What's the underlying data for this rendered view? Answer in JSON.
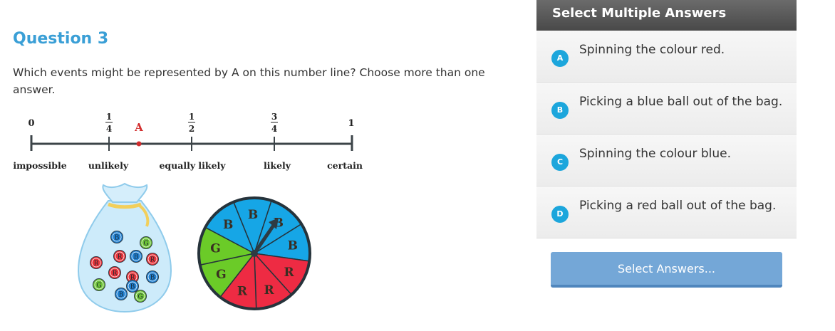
{
  "question": {
    "title": "Question 3",
    "text": "Which events might be represented by A on this number line? Choose more than one answer."
  },
  "number_line": {
    "ticks": [
      {
        "label": "0",
        "caption": "impossible"
      },
      {
        "num": "1",
        "den": "4",
        "caption": "unlikely"
      },
      {
        "num": "1",
        "den": "2",
        "caption": "equally likely"
      },
      {
        "num": "3",
        "den": "4",
        "caption": "likely"
      },
      {
        "label": "1",
        "caption": "certain"
      }
    ],
    "marker_label": "A",
    "marker_color": "#d12c2c"
  },
  "bag": {
    "balls": [
      "B",
      "G",
      "R",
      "R",
      "B",
      "R",
      "R",
      "R",
      "B",
      "G",
      "B",
      "B",
      "G",
      "R"
    ],
    "colors": {
      "R": "#e8333a",
      "B": "#1f7fd0",
      "G": "#6cc137"
    }
  },
  "spinner": {
    "sectors": [
      "B",
      "B",
      "B",
      "R",
      "R",
      "R",
      "G",
      "G",
      "B"
    ],
    "colors": {
      "R": "#ee2b43",
      "B": "#16a6e6",
      "G": "#6bcb28"
    }
  },
  "panel": {
    "header": "Select Multiple Answers",
    "options": [
      {
        "letter": "A",
        "text": "Spinning the colour red."
      },
      {
        "letter": "B",
        "text": "Picking a blue ball out of the bag."
      },
      {
        "letter": "C",
        "text": "Spinning the colour blue."
      },
      {
        "letter": "D",
        "text": "Picking a red ball out of the bag."
      }
    ],
    "submit": "Select Answers..."
  }
}
